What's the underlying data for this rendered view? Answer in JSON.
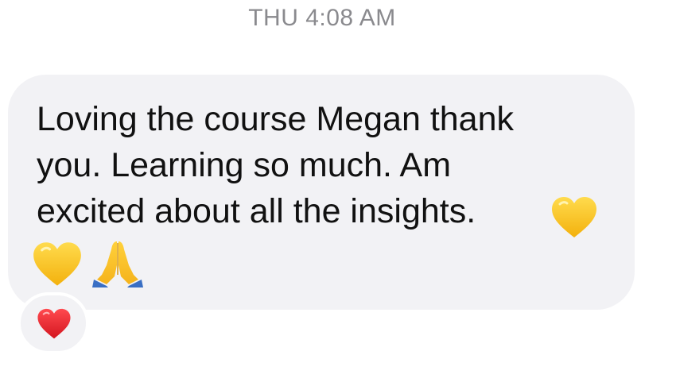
{
  "header": {
    "timestamp": "THU 4:08 AM"
  },
  "message": {
    "lines": [
      "Loving the course Megan thank",
      "you. Learning so much. Am",
      "excited about all the insights."
    ],
    "emoji": [
      {
        "name": "yellow-heart-icon",
        "glyph": "💛"
      },
      {
        "name": "yellow-heart-icon",
        "glyph": "💛"
      },
      {
        "name": "folded-hands-icon",
        "glyph": "🙏"
      }
    ],
    "bubble_color": "#f2f2f5",
    "text_color": "#111111"
  },
  "reaction": {
    "name": "red-heart-icon",
    "glyph": "❤️",
    "color": "#e0252b"
  },
  "colors": {
    "timestamp": "#8a8a8e",
    "yellow_heart": "#f7c51d",
    "background": "#ffffff"
  }
}
